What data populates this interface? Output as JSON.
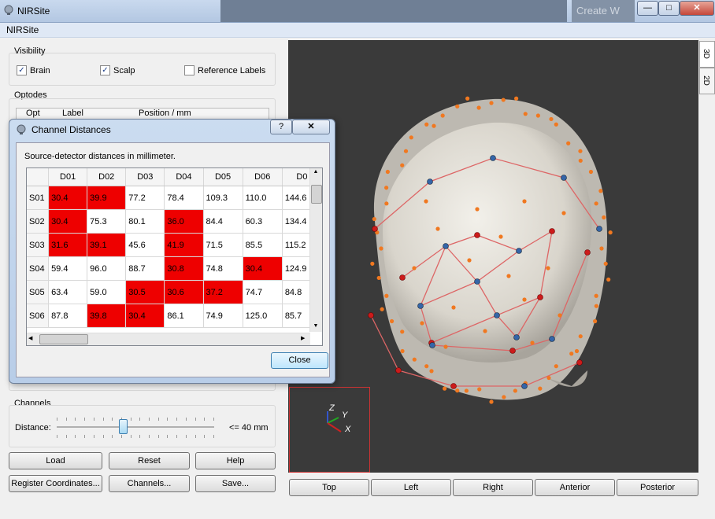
{
  "window": {
    "title": "NIRSite",
    "menu": "NIRSite",
    "bg_text": "Create W"
  },
  "visibility": {
    "title": "Visibility",
    "brain": "Brain",
    "scalp": "Scalp",
    "reference_labels": "Reference Labels",
    "brain_checked": true,
    "scalp_checked": true,
    "reference_checked": false
  },
  "optodes": {
    "title": "Optodes",
    "col_opt": "Opt",
    "col_label": "Label",
    "col_position": "Position / mm"
  },
  "channels": {
    "title": "Channels",
    "distance_label": "Distance:",
    "distance_value": "<= 40 mm",
    "slider_fraction": 0.42
  },
  "buttons": {
    "load": "Load",
    "reset": "Reset",
    "help": "Help",
    "register": "Register Coordinates...",
    "channels": "Channels...",
    "save": "Save..."
  },
  "view_tabs": {
    "tab_3d": "3D",
    "tab_2d": "2D"
  },
  "axes": {
    "z": "Z",
    "y": "Y",
    "x": "X"
  },
  "view_buttons": {
    "top": "Top",
    "left": "Left",
    "right": "Right",
    "anterior": "Anterior",
    "posterior": "Posterior"
  },
  "dialog": {
    "title": "Channel Distances",
    "help": "?",
    "caption": "Source-detector distances in millimeter.",
    "close": "Close",
    "columns": [
      "D01",
      "D02",
      "D03",
      "D04",
      "D05",
      "D06",
      "D0"
    ],
    "rows": [
      {
        "label": "S01",
        "cells": [
          "30.4",
          "39.9",
          "77.2",
          "78.4",
          "109.3",
          "110.0",
          "144.6"
        ],
        "red": [
          true,
          true,
          false,
          false,
          false,
          false,
          false
        ]
      },
      {
        "label": "S02",
        "cells": [
          "30.4",
          "75.3",
          "80.1",
          "36.0",
          "84.4",
          "60.3",
          "134.4"
        ],
        "red": [
          true,
          false,
          false,
          true,
          false,
          false,
          false
        ]
      },
      {
        "label": "S03",
        "cells": [
          "31.6",
          "39.1",
          "45.6",
          "41.9",
          "71.5",
          "85.5",
          "115.2"
        ],
        "red": [
          true,
          true,
          false,
          true,
          false,
          false,
          false
        ]
      },
      {
        "label": "S04",
        "cells": [
          "59.4",
          "96.0",
          "88.7",
          "30.8",
          "74.8",
          "30.4",
          "124.9"
        ],
        "red": [
          false,
          false,
          false,
          true,
          false,
          true,
          false
        ]
      },
      {
        "label": "S05",
        "cells": [
          "63.4",
          "59.0",
          "30.5",
          "30.6",
          "37.2",
          "74.7",
          "84.8"
        ],
        "red": [
          false,
          false,
          true,
          true,
          true,
          false,
          false
        ]
      },
      {
        "label": "S06",
        "cells": [
          "87.8",
          "39.8",
          "30.4",
          "86.1",
          "74.9",
          "125.0",
          "85.7"
        ],
        "red": [
          false,
          true,
          true,
          false,
          false,
          false,
          false
        ]
      }
    ]
  },
  "colors": {
    "highlight": "#ee0000",
    "viewport": "#3a3a3a"
  }
}
